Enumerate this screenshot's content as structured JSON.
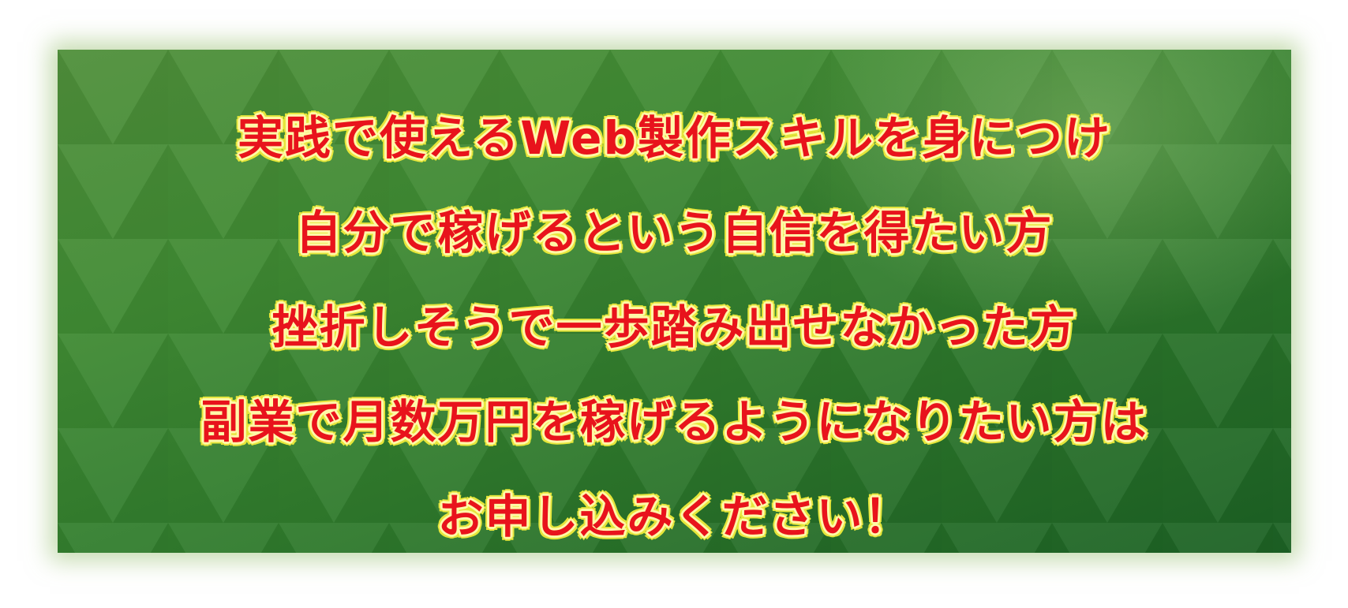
{
  "banner": {
    "lines": [
      "実践で使えるWeb製作スキルを身につけ",
      "自分で稼げるという自信を得たい方",
      "挫折しそうで一歩踏み出せなかった方",
      "副業で月数万円を稼げるようになりたい方は",
      "お申し込みください！"
    ],
    "text_color": "#e8131c",
    "outline_color": "#e6e63a",
    "background_color": "#2f7a2c"
  }
}
